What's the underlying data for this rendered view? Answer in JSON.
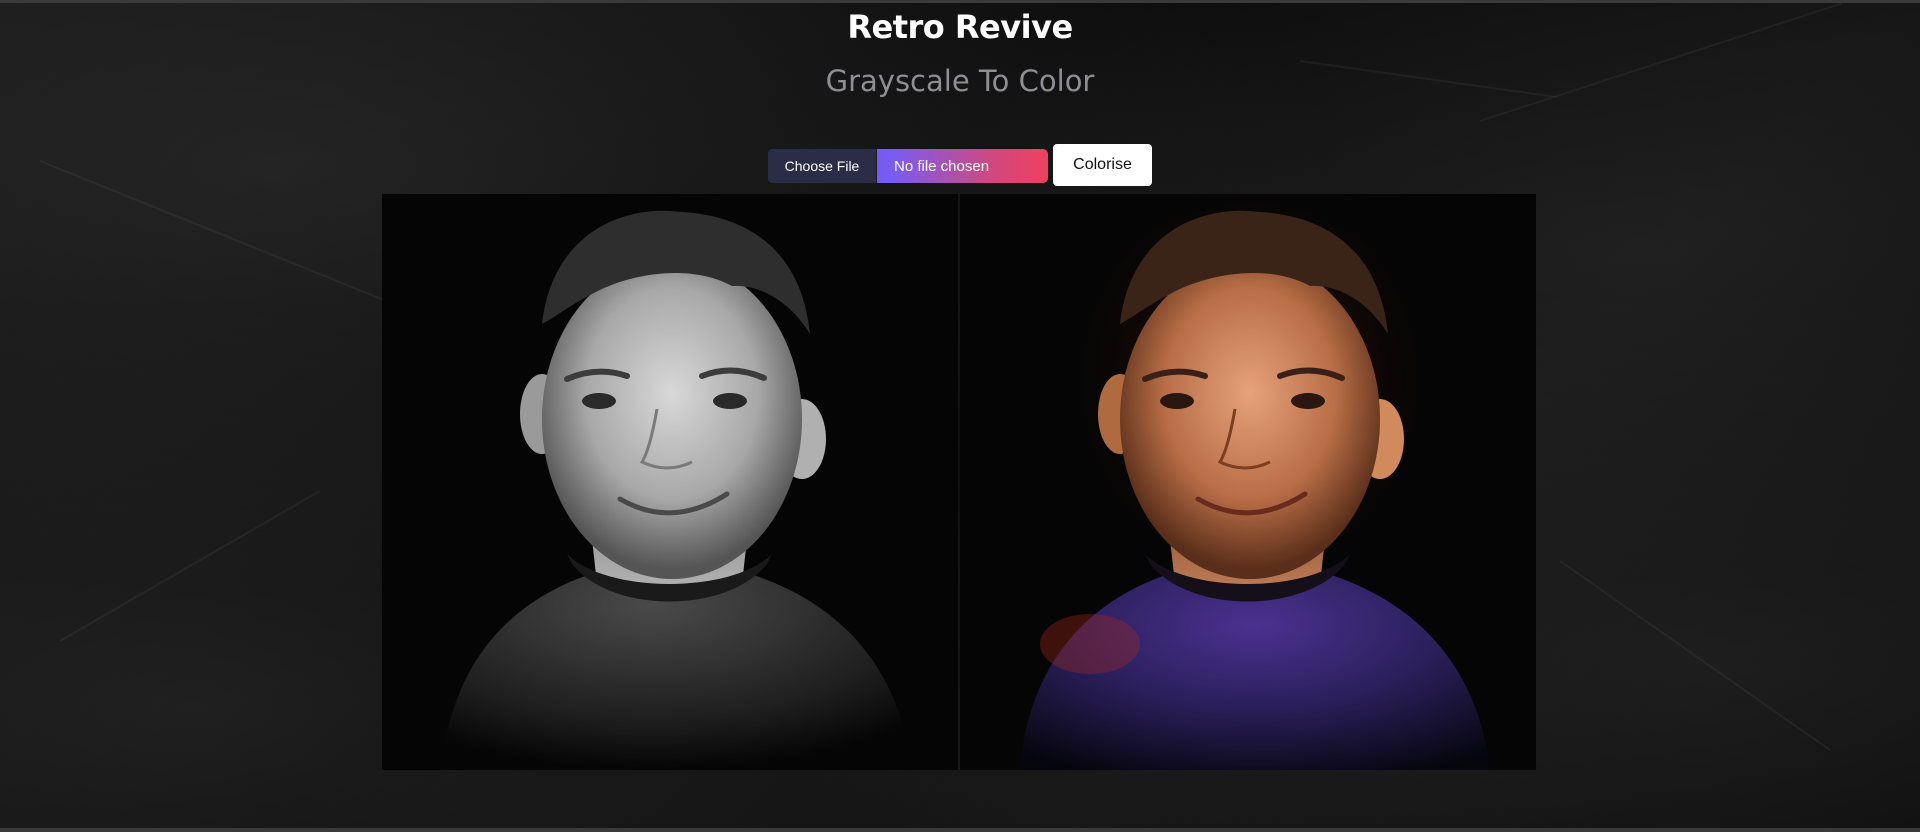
{
  "app": {
    "title": "Retro Revive",
    "subtitle": "Grayscale To Color"
  },
  "upload": {
    "choose_label": "Choose File",
    "status": "No file chosen"
  },
  "actions": {
    "colorise_label": "Colorise"
  },
  "colors": {
    "upload_gradient_start": "#4b55ff",
    "upload_gradient_end": "#f04060",
    "colorise_bg": "#ffffff"
  }
}
